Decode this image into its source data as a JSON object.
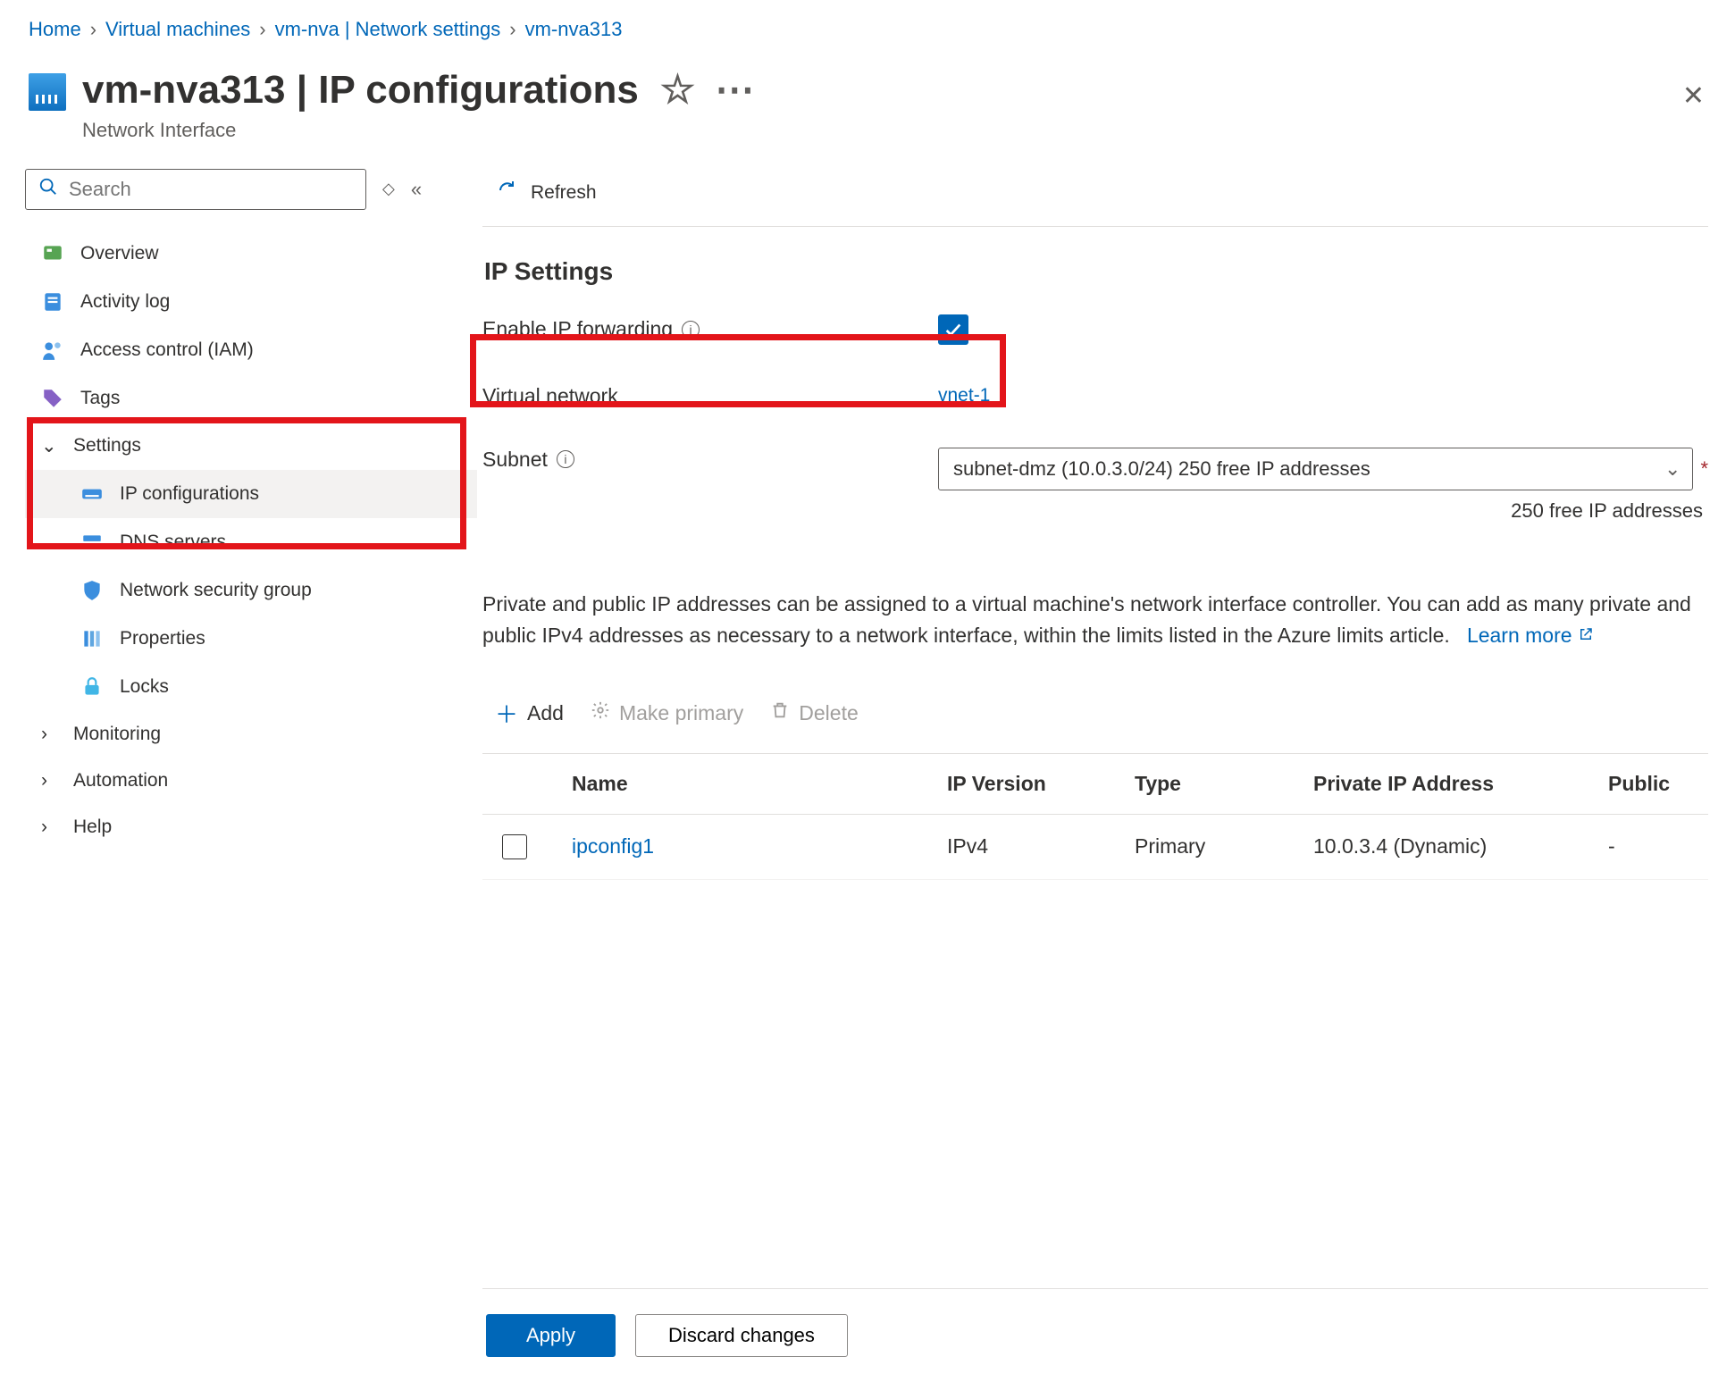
{
  "breadcrumb": [
    {
      "label": "Home"
    },
    {
      "label": "Virtual machines"
    },
    {
      "label": "vm-nva | Network settings"
    },
    {
      "label": "vm-nva313"
    }
  ],
  "header": {
    "title": "vm-nva313 | IP configurations",
    "subtitle": "Network Interface"
  },
  "sidebar": {
    "search_placeholder": "Search",
    "items": [
      {
        "label": "Overview"
      },
      {
        "label": "Activity log"
      },
      {
        "label": "Access control (IAM)"
      },
      {
        "label": "Tags"
      }
    ],
    "settings_label": "Settings",
    "settings_items": [
      {
        "label": "IP configurations",
        "selected": true
      },
      {
        "label": "DNS servers"
      },
      {
        "label": "Network security group"
      },
      {
        "label": "Properties"
      },
      {
        "label": "Locks"
      }
    ],
    "collapsed": [
      {
        "label": "Monitoring"
      },
      {
        "label": "Automation"
      },
      {
        "label": "Help"
      }
    ]
  },
  "toolbar": {
    "refresh": "Refresh"
  },
  "settings": {
    "title": "IP Settings",
    "ip_forwarding_label": "Enable IP forwarding",
    "ip_forwarding_checked": true,
    "vnet_label": "Virtual network",
    "vnet_value": "vnet-1",
    "subnet_label": "Subnet",
    "subnet_value": "subnet-dmz (10.0.3.0/24) 250 free IP addresses",
    "subnet_helper": "250 free IP addresses",
    "description": "Private and public IP addresses can be assigned to a virtual machine's network interface controller. You can add as many private and public IPv4 addresses as necessary to a network interface, within the limits listed in the Azure limits article.",
    "learn_more": "Learn more"
  },
  "list_toolbar": {
    "add": "Add",
    "make_primary": "Make primary",
    "delete": "Delete"
  },
  "table": {
    "columns": {
      "name": "Name",
      "ip_version": "IP Version",
      "type": "Type",
      "private_ip": "Private IP Address",
      "public": "Public"
    },
    "rows": [
      {
        "name": "ipconfig1",
        "ip_version": "IPv4",
        "type": "Primary",
        "private_ip": "10.0.3.4 (Dynamic)",
        "public": "-"
      }
    ]
  },
  "footer": {
    "apply": "Apply",
    "discard": "Discard changes"
  }
}
